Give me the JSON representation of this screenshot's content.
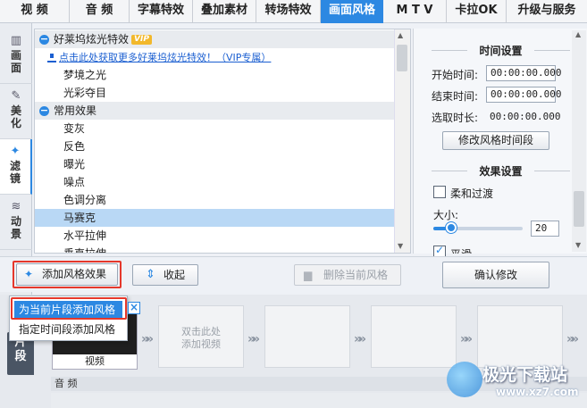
{
  "tabs": [
    {
      "label": "视 频"
    },
    {
      "label": "音 频"
    },
    {
      "label": "字幕特效"
    },
    {
      "label": "叠加素材"
    },
    {
      "label": "转场特效"
    },
    {
      "label": "画面风格"
    },
    {
      "label": "M T V"
    },
    {
      "label": "卡拉OK"
    },
    {
      "label": "升级与服务"
    }
  ],
  "side_tabs": [
    {
      "label": "画面",
      "icon": "film-icon"
    },
    {
      "label": "美化",
      "icon": "magic-wand-icon"
    },
    {
      "label": "滤镜",
      "icon": "wand-sparkle-icon"
    },
    {
      "label": "动景",
      "icon": "waves-icon"
    }
  ],
  "effects": {
    "hollywood_category": "好莱坞炫光特效",
    "vip_badge": "VIP",
    "vip_link": "点击此处获取更多好莱坞炫光特效！（VIP专属）",
    "hollywood_items": [
      "梦境之光",
      "光彩夺目"
    ],
    "common_category": "常用效果",
    "common_items": [
      "变灰",
      "反色",
      "曝光",
      "噪点",
      "色调分离",
      "马赛克",
      "水平拉伸",
      "垂直拉伸"
    ],
    "selected": "马赛克"
  },
  "time_settings": {
    "header": "时间设置",
    "start_label": "开始时间:",
    "start_value": "00:00:00.000",
    "end_label": "结束时间:",
    "end_value": "00:00:00.000",
    "duration_label": "选取时长:",
    "duration_value": "00:00:00.000",
    "modify_button": "修改风格时间段"
  },
  "effect_settings": {
    "header": "效果设置",
    "soft_transition": "柔和过渡",
    "soft_transition_checked": false,
    "size_label": "大小:",
    "size_value": "20",
    "size_fraction": 0.2,
    "smooth_label": "平滑",
    "smooth_checked": true,
    "confirm_button": "确认修改"
  },
  "toolbar": {
    "add_effect": "添加风格效果",
    "collapse": "收起",
    "delete_current": "删除当前风格"
  },
  "dropdown": {
    "items": [
      "为当前片段添加风格",
      "指定时间段添加风格"
    ],
    "highlighted_index": 0
  },
  "timeline": {
    "side_label": "片段",
    "clip_label": "视频",
    "placeholder": "双击此处\n添加视频",
    "audio_label": "音 频"
  },
  "watermark": {
    "brand": "极光下载站",
    "url": "www.xz7.com"
  },
  "colors": {
    "accent": "#2c88e2",
    "highlight": "#b9d8f5",
    "annotation_red": "#e5372b"
  }
}
